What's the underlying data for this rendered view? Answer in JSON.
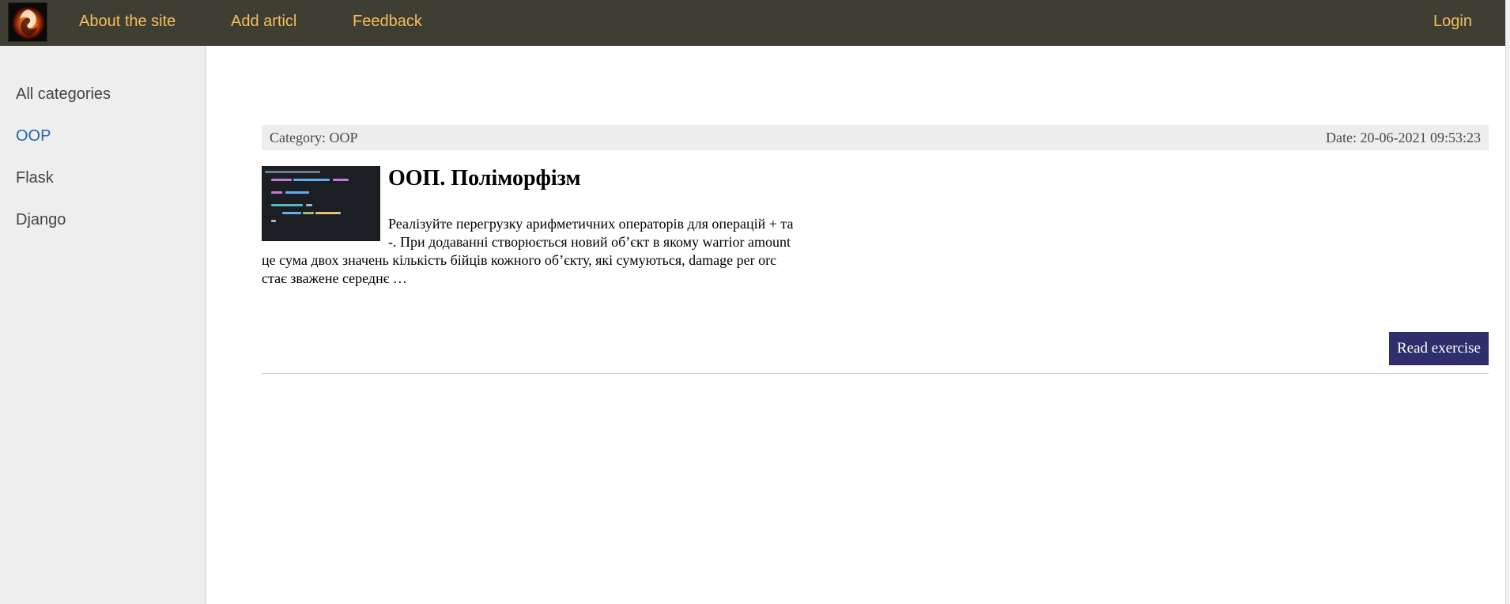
{
  "nav": {
    "logo": "logo-icon",
    "about": "About the site",
    "add_article": "Add articl",
    "feedback": "Feedback",
    "login": "Login"
  },
  "sidebar": {
    "items": [
      {
        "label": "All categories",
        "active": false
      },
      {
        "label": "OOP",
        "active": true
      },
      {
        "label": "Flask",
        "active": false
      },
      {
        "label": "Django",
        "active": false
      }
    ]
  },
  "article": {
    "category": "Category: OOP",
    "date": "Date: 20-06-2021 09:53:23",
    "title": "ООП. Поліморфізм",
    "excerpt": "Реалізуйте перегрузку арифметичних операторів для операцій + та -. При додаванні створюється новий об’єкт в якому warrior amount це сума двох значень кількість бійців кожного об’єкту, які сумуються, damage per orc стає зважене середнє …",
    "thumbnail": "code-screenshot-image",
    "read_button": "Read exercise"
  },
  "colors": {
    "topbar": "#3f3e33",
    "nav_link": "#f6bd5c",
    "sidebar_bg": "#eeeeee",
    "active_link": "#2a64a8",
    "button_bg": "#2e2f6b"
  }
}
